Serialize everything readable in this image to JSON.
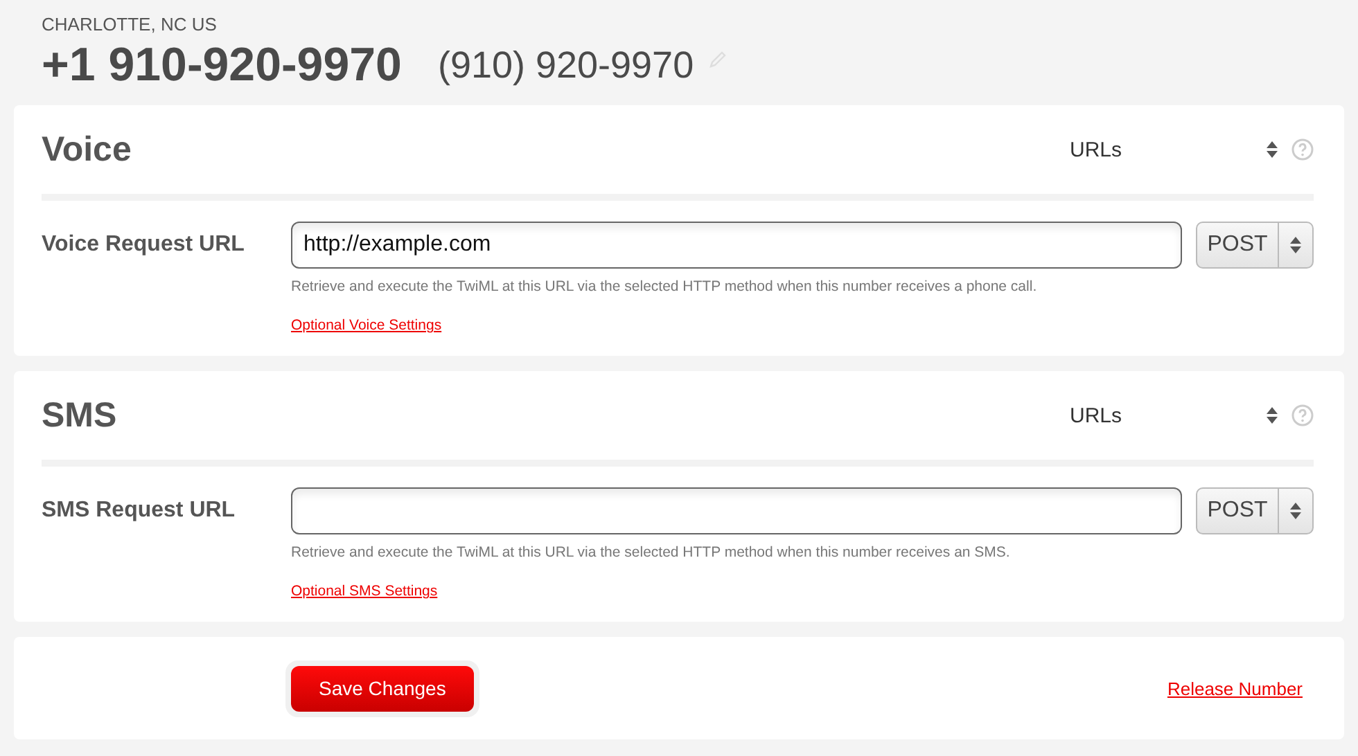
{
  "header": {
    "location": "CHARLOTTE, NC US",
    "number": "+1 910-920-9970",
    "friendly_name": "(910) 920-9970"
  },
  "sections": [
    {
      "title": "Voice",
      "mode": "URLs",
      "label": "Voice Request URL",
      "url_value": "http://example.com",
      "method": "POST",
      "hint": "Retrieve and execute the TwiML at this URL via the selected HTTP method when this number receives a phone call.",
      "link": "Optional Voice Settings"
    },
    {
      "title": "SMS",
      "mode": "URLs",
      "label": "SMS Request URL",
      "method": "POST",
      "hint": "Retrieve and execute the TwiML at this URL via the selected HTTP method when this number receives an SMS.",
      "link": "Optional SMS Settings"
    }
  ],
  "footer": {
    "save_button": "Save Changes",
    "release_link": "Release Number"
  }
}
